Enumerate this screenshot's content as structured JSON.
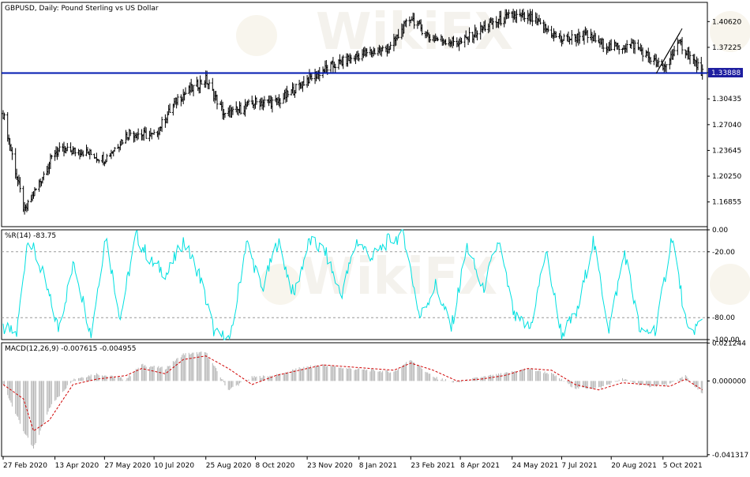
{
  "chart_data": [
    {
      "type": "bar",
      "name": "price",
      "title": "GBPUSD, Daily:  Pound Sterling vs US Dollar",
      "ylim": [
        1.136,
        1.4315
      ],
      "y_ticks": [
        "1.40620",
        "1.37225",
        "1.33888",
        "1.30435",
        "1.27040",
        "1.23645",
        "1.20250",
        "1.16855"
      ],
      "current_price": 1.33888,
      "current_price_label": "1.33888",
      "horizontal_line": 1.3384,
      "colors": {
        "bars": "#000000",
        "level_line": "#0018b0",
        "price_tag": "#1e1ea0"
      },
      "dates": [
        "2020-02-27",
        "2020-03-17",
        "2020-04-13",
        "2020-05-06",
        "2020-05-27",
        "2020-06-18",
        "2020-07-10",
        "2020-07-31",
        "2020-08-25",
        "2020-09-11",
        "2020-10-08",
        "2020-10-28",
        "2020-11-23",
        "2020-12-11",
        "2021-01-08",
        "2021-02-05",
        "2021-02-23",
        "2021-03-12",
        "2021-04-08",
        "2021-05-03",
        "2021-05-24",
        "2021-06-10",
        "2021-07-07",
        "2021-07-28",
        "2021-08-20",
        "2021-09-10",
        "2021-10-05",
        "2021-10-20",
        "2021-11-09"
      ],
      "close": [
        1.285,
        1.155,
        1.235,
        1.236,
        1.225,
        1.26,
        1.255,
        1.305,
        1.33,
        1.282,
        1.3,
        1.3,
        1.33,
        1.345,
        1.362,
        1.372,
        1.412,
        1.385,
        1.378,
        1.402,
        1.414,
        1.41,
        1.382,
        1.388,
        1.372,
        1.375,
        1.344,
        1.378,
        1.339
      ],
      "channel_lines": [
        {
          "start": [
            "2021-09-29",
            1.338
          ],
          "end": [
            "2021-10-20",
            1.3915
          ]
        },
        {
          "start": [
            "2021-10-01",
            1.3435
          ],
          "end": [
            "2021-10-22",
            1.397
          ]
        }
      ]
    },
    {
      "type": "line",
      "name": "williams_r",
      "label": "%R(14) -83.75",
      "ylim": [
        -100,
        0
      ],
      "y_ticks": [
        "0.00",
        "-20.00",
        "-80.00",
        "-100.00"
      ],
      "levels": [
        -20,
        -80
      ],
      "color": "#00e0e0",
      "dates": [
        "2020-02-27",
        "2020-03-10",
        "2020-03-20",
        "2020-04-02",
        "2020-04-16",
        "2020-04-30",
        "2020-05-15",
        "2020-05-28",
        "2020-06-10",
        "2020-06-24",
        "2020-07-08",
        "2020-07-22",
        "2020-08-05",
        "2020-08-19",
        "2020-09-02",
        "2020-09-16",
        "2020-09-30",
        "2020-10-14",
        "2020-10-28",
        "2020-11-11",
        "2020-11-25",
        "2020-12-09",
        "2020-12-23",
        "2021-01-06",
        "2021-01-20",
        "2021-02-03",
        "2021-02-17",
        "2021-03-03",
        "2021-03-17",
        "2021-03-31",
        "2021-04-14",
        "2021-04-28",
        "2021-05-12",
        "2021-05-26",
        "2021-06-09",
        "2021-06-23",
        "2021-07-07",
        "2021-07-21",
        "2021-08-04",
        "2021-08-18",
        "2021-09-01",
        "2021-09-15",
        "2021-09-29",
        "2021-10-13",
        "2021-10-27",
        "2021-11-09"
      ],
      "values": [
        -90,
        -95,
        -5,
        -40,
        -90,
        -30,
        -95,
        -5,
        -80,
        -5,
        -30,
        -40,
        -10,
        -40,
        -95,
        -100,
        -10,
        -55,
        -10,
        -60,
        -10,
        -20,
        -60,
        -10,
        -25,
        -10,
        -5,
        -80,
        -50,
        -90,
        -15,
        -55,
        -10,
        -80,
        -90,
        -20,
        -95,
        -75,
        -10,
        -90,
        -20,
        -95,
        -90,
        -5,
        -95,
        -83.75
      ]
    },
    {
      "type": "bar",
      "name": "macd",
      "label": "MACD(12,26,9) -0.007615 -0.004955",
      "ylim": [
        -0.0423,
        0.0214
      ],
      "y_ticks": [
        "0.021244",
        "0.000000",
        "-0.041317"
      ],
      "colors": {
        "histogram": "#b4b4b4",
        "signal": "#d00000"
      },
      "dates": [
        "2020-02-27",
        "2020-03-16",
        "2020-03-25",
        "2020-04-08",
        "2020-04-29",
        "2020-05-20",
        "2020-06-15",
        "2020-06-29",
        "2020-07-20",
        "2020-08-05",
        "2020-08-25",
        "2020-09-14",
        "2020-10-05",
        "2020-10-26",
        "2020-11-16",
        "2020-12-07",
        "2020-12-28",
        "2021-01-18",
        "2021-02-08",
        "2021-02-23",
        "2021-03-15",
        "2021-04-05",
        "2021-04-26",
        "2021-05-17",
        "2021-06-07",
        "2021-06-28",
        "2021-07-19",
        "2021-08-09",
        "2021-08-30",
        "2021-09-20",
        "2021-10-11",
        "2021-10-25",
        "2021-11-09"
      ],
      "histogram": [
        -0.002,
        -0.028,
        -0.038,
        -0.015,
        0.001,
        0.004,
        0.001,
        0.009,
        0.007,
        0.015,
        0.016,
        -0.005,
        0.002,
        0.003,
        0.007,
        0.009,
        0.007,
        0.006,
        0.005,
        0.012,
        0.002,
        -0.001,
        0.002,
        0.004,
        0.007,
        0.004,
        -0.004,
        -0.004,
        0.001,
        -0.003,
        -0.002,
        0.003,
        -0.0076
      ],
      "signal": [
        -0.002,
        -0.01,
        -0.028,
        -0.022,
        -0.002,
        0.001,
        0.003,
        0.007,
        0.004,
        0.012,
        0.014,
        0.007,
        -0.002,
        0.003,
        0.006,
        0.009,
        0.008,
        0.007,
        0.006,
        0.01,
        0.006,
        0.0,
        0.001,
        0.003,
        0.007,
        0.006,
        -0.002,
        -0.005,
        -0.001,
        -0.002,
        -0.003,
        0.001,
        -0.00496
      ]
    }
  ],
  "x_axis": {
    "labels": [
      {
        "date": "2020-02-27",
        "text": "27 Feb 2020"
      },
      {
        "date": "2020-04-13",
        "text": "13 Apr 2020"
      },
      {
        "date": "2020-05-27",
        "text": "27 May 2020"
      },
      {
        "date": "2020-07-10",
        "text": "10 Jul 2020"
      },
      {
        "date": "2020-08-25",
        "text": "25 Aug 2020"
      },
      {
        "date": "2020-10-08",
        "text": "8 Oct 2020"
      },
      {
        "date": "2020-11-23",
        "text": "23 Nov 2020"
      },
      {
        "date": "2021-01-08",
        "text": "8 Jan 2021"
      },
      {
        "date": "2021-02-23",
        "text": "23 Feb 2021"
      },
      {
        "date": "2021-04-08",
        "text": "8 Apr 2021"
      },
      {
        "date": "2021-05-24",
        "text": "24 May 2021"
      },
      {
        "date": "2021-07-07",
        "text": "7 Jul 2021"
      },
      {
        "date": "2021-08-20",
        "text": "20 Aug 2021"
      },
      {
        "date": "2021-10-05",
        "text": "5 Oct 2021"
      }
    ]
  },
  "watermark": "WikiFX"
}
